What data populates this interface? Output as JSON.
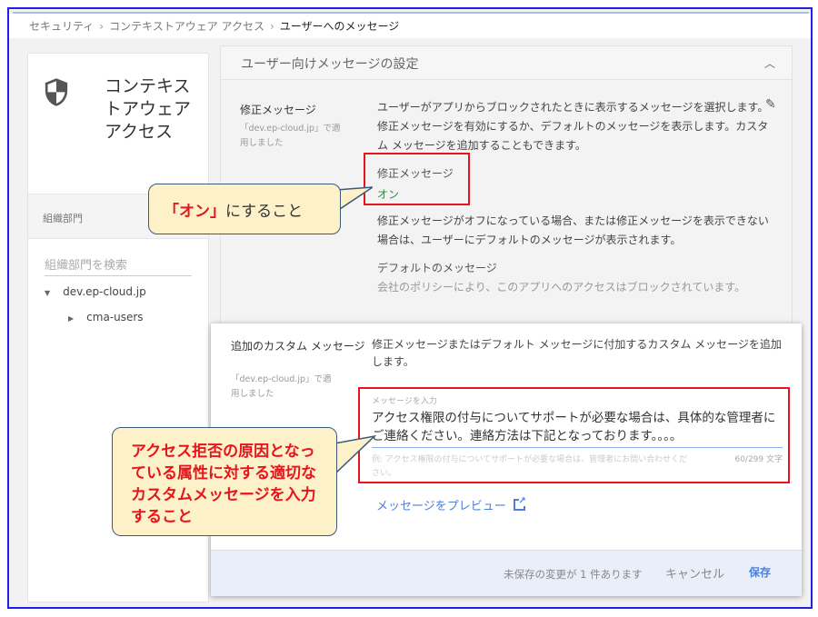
{
  "breadcrumb": {
    "items": [
      "セキュリティ",
      "コンテキストアウェア アクセス",
      "ユーザーへのメッセージ"
    ],
    "separator": "›"
  },
  "sidebar": {
    "title": "コンテキストアウェア アクセス",
    "icon": "shield-icon",
    "section_label": "組織部門",
    "search_placeholder": "組織部門を検索",
    "tree": [
      {
        "label": "dev.ep-cloud.jp",
        "expanded": true
      },
      {
        "label": "cma-users",
        "expanded": false
      }
    ]
  },
  "panel": {
    "title": "ユーザー向けメッセージの設定",
    "remediation": {
      "label": "修正メッセージ",
      "applied": "「dev.ep-cloud.jp」で適用しました",
      "description": "ユーザーがアプリからブロックされたときに表示するメッセージを選択します。修正メッセージを有効にするか、デフォルトのメッセージを表示します。カスタム メッセージを追加することもできます。",
      "setting_label": "修正メッセージ",
      "setting_value": "オン",
      "off_note": "修正メッセージがオフになっている場合、または修正メッセージを表示できない場合は、ユーザーにデフォルトのメッセージが表示されます。",
      "default_label": "デフォルトのメッセージ",
      "default_value": "会社のポリシーにより、このアプリへのアクセスはブロックされています。"
    },
    "custom": {
      "label": "追加のカスタム メッセージ",
      "applied": "「dev.ep-cloud.jp」で適用しました",
      "description": "修正メッセージまたはデフォルト メッセージに付加するカスタム メッセージを追加します。",
      "input_label": "メッセージを入力",
      "input_value": "アクセス権限の付与についてサポートが必要な場合は、具体的な管理者にご連絡ください。連絡方法は下記となっております。。。。",
      "hint": "例: アクセス権限の付与についてサポートが必要な場合は、管理者にお問い合わせください。",
      "counter": "60/299 文字",
      "preview_link": "メッセージをプレビュー"
    },
    "footer": {
      "unsaved": "未保存の変更が 1 件あります",
      "cancel": "キャンセル",
      "save": "保存"
    }
  },
  "annotations": {
    "callout1_em": "「オン」",
    "callout1_rest": "にすること",
    "callout2": "アクセス拒否の原因となっている属性に対する適切なカスタムメッセージを入力すること"
  },
  "colors": {
    "accent": "#4a7fe0",
    "on": "#2e8b3e",
    "highlight": "#e8141b",
    "callout_bg": "#fdf1c9"
  }
}
